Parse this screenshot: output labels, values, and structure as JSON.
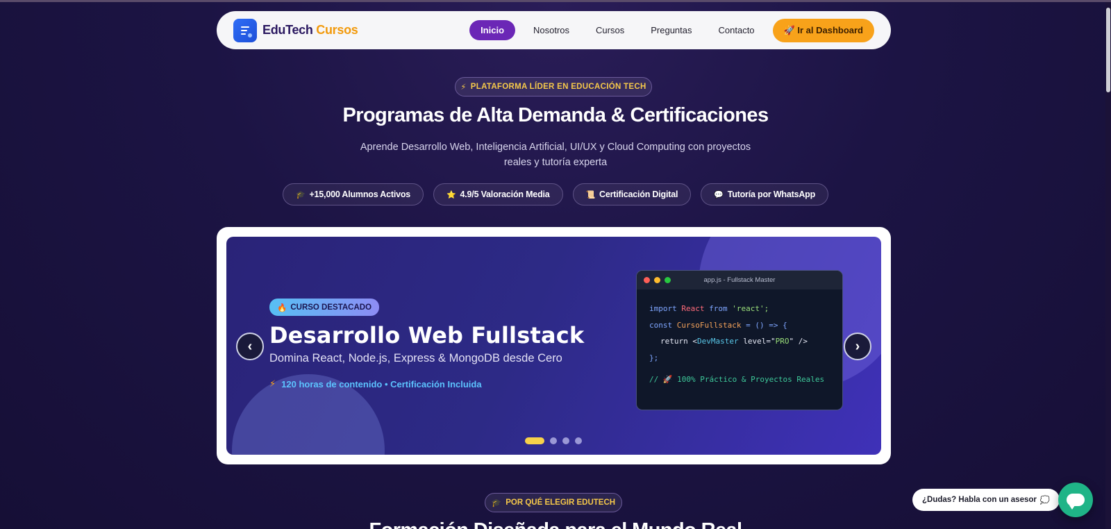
{
  "nav": {
    "brand_main": "EduTech",
    "brand_accent": "Cursos",
    "links": [
      "Inicio",
      "Nosotros",
      "Cursos",
      "Preguntas",
      "Contacto"
    ],
    "cta_icon": "🚀",
    "cta": "Ir al Dashboard"
  },
  "hero": {
    "badge_icon": "⚡",
    "badge": "PLATAFORMA LÍDER EN EDUCACIÓN TECH",
    "title": "Programas de Alta Demanda & Certificaciones",
    "subtitle": "Aprende Desarrollo Web, Inteligencia Artificial, UI/UX y Cloud Computing con proyectos reales y tutoría experta",
    "pills": [
      {
        "icon": "🎓",
        "label": "+15,000 Alumnos Activos"
      },
      {
        "icon": "⭐",
        "label": "4.9/5 Valoración Media"
      },
      {
        "icon": "📜",
        "label": "Certificación Digital"
      },
      {
        "icon": "💬",
        "label": "Tutoría por WhatsApp"
      }
    ]
  },
  "carousel": {
    "badge_icon": "🔥",
    "badge": "CURSO DESTACADO",
    "title": "Desarrollo Web Fullstack",
    "subtitle": "Domina React, Node.js, Express & MongoDB desde Cero",
    "meta_icon": "⚡",
    "meta": "120 horas de contenido • Certificación Incluida",
    "prev": "‹",
    "next": "›",
    "active_slide": 1,
    "slide_count": 4,
    "code": {
      "window_title": "app.js - Fullstack Master",
      "l1_kw": "import",
      "l1_id": "React",
      "l1_from": "from",
      "l1_str": "'react';",
      "l2_kw": "const",
      "l2_fn": "CursoFullstack",
      "l2_rest": "= () => {",
      "l3_ret": "return",
      "l3_open": "<",
      "l3_tag": "DevMaster",
      "l3_attr": "level=",
      "l3_q1": "\"",
      "l3_val": "PRO",
      "l3_q2": "\"",
      "l3_close": "/>",
      "l4": "};",
      "comment": "// 🚀 100% Práctico & Proyectos Reales"
    }
  },
  "section2": {
    "badge_icon": "🎓",
    "badge": "POR QUÉ ELEGIR EDUTECH",
    "title": "Formación Diseñada para el Mundo Real"
  },
  "chat": {
    "label": "¿Dudas? Habla con un asesor",
    "icon": "💭"
  }
}
